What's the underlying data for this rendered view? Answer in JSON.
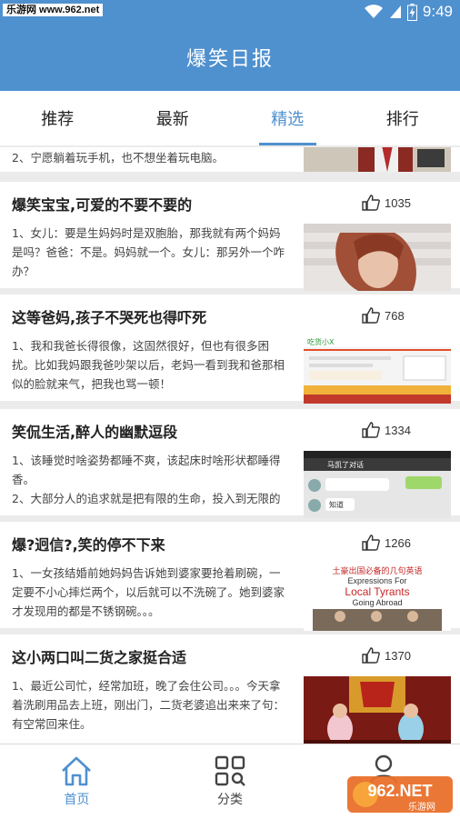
{
  "status": {
    "watermark": "乐游网 www.962.net",
    "time": "9:49"
  },
  "app": {
    "title": "爆笑日报"
  },
  "tabs": [
    {
      "label": "推荐",
      "active": false
    },
    {
      "label": "最新",
      "active": false
    },
    {
      "label": "精选",
      "active": true
    },
    {
      "label": "排行",
      "active": false
    }
  ],
  "partial_card": {
    "text": "2、宁愿躺着玩手机，也不想坐着玩电脑。"
  },
  "cards": [
    {
      "title": "爆笑宝宝,可爱的不要不要的",
      "likes": "1035",
      "lines": [
        "1、女儿：要是生妈妈时是双胞胎，那我就有两个妈妈是吗？爸爸：不是。妈妈就一个。女儿：那另外一个咋办？"
      ]
    },
    {
      "title": "这等爸妈,孩子不哭死也得吓死",
      "likes": "768",
      "lines": [
        "1、我和我爸长得很像，这固然很好，但也有很多困扰。比如我妈跟我爸吵架以后，老妈一看到我和爸那相似的脸就来气，把我也骂一顿！"
      ]
    },
    {
      "title": "笑侃生活,醉人的幽默逗段",
      "likes": "1334",
      "lines": [
        "1、该睡觉时啥姿势都睡不爽，该起床时啥形状都睡得香。",
        "2、大部分人的追求就是把有限的生命，投入到无限的"
      ]
    },
    {
      "title": "爆?迥信?,笑的停不下来",
      "likes": "1266",
      "lines": [
        "1、一女孩结婚前她妈妈告诉她到婆家要抢着刷碗，一定要不小心摔烂两个，以后就可以不洗碗了。她到婆家才发现用的都是不锈钢碗。。。"
      ]
    },
    {
      "title": "这小两口叫二货之家挺合适",
      "likes": "1370",
      "lines": [
        "1、最近公司忙，经常加班，晚了会住公司。。。今天拿着洗刷用品去上班，刚出门，二货老婆追出来来了句：有空常回来住。"
      ]
    }
  ],
  "thumb_text": {
    "t2_brand": "吃货小X",
    "t3_chat": "马凯了对话",
    "t3_bubble": "知道",
    "t4_line1": "土豪出国必备的几句英语",
    "t4_line2": "Expressions For",
    "t4_line3": "Local Tyrants",
    "t4_line4": "Going Abroad"
  },
  "bottom_nav": [
    {
      "label": "首页",
      "icon": "home-icon",
      "active": true
    },
    {
      "label": "分类",
      "icon": "grid-icon",
      "active": false
    },
    {
      "label": "",
      "icon": "user-icon",
      "active": false
    }
  ],
  "corner_logo": {
    "text": "962.NET",
    "sub": "乐游网"
  },
  "colors": {
    "accent": "#4f90cf",
    "background": "#ebebeb"
  }
}
